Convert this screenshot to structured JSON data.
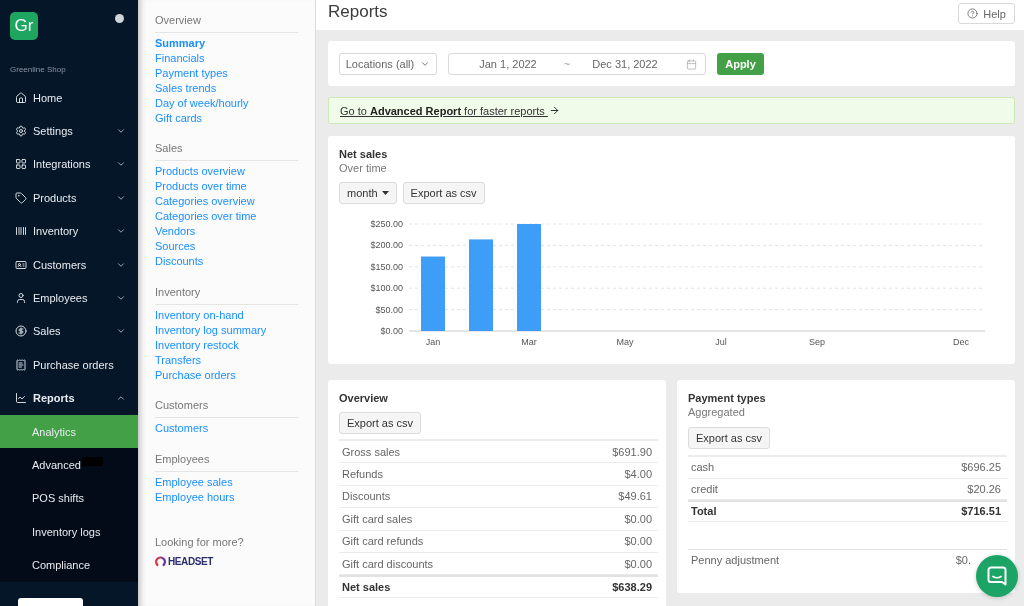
{
  "sidebar": {
    "logo": "Gr",
    "shop_name": "Greenline Shop",
    "items": [
      {
        "label": "Home",
        "kind": "link",
        "selected": false
      },
      {
        "label": "Settings",
        "kind": "group",
        "expanded": false,
        "selected": false
      },
      {
        "label": "Integrations",
        "kind": "group",
        "expanded": false,
        "selected": false
      },
      {
        "label": "Products",
        "kind": "group",
        "expanded": false,
        "selected": false
      },
      {
        "label": "Inventory",
        "kind": "group",
        "expanded": false,
        "selected": false
      },
      {
        "label": "Customers",
        "kind": "group",
        "expanded": false,
        "selected": false
      },
      {
        "label": "Employees",
        "kind": "group",
        "expanded": false,
        "selected": false
      },
      {
        "label": "Sales",
        "kind": "group",
        "expanded": false,
        "selected": false
      },
      {
        "label": "Purchase orders",
        "kind": "link",
        "selected": false
      },
      {
        "label": "Reports",
        "kind": "group",
        "expanded": true,
        "selected": true,
        "children": [
          {
            "label": "Analytics",
            "selected": true,
            "redacted": false
          },
          {
            "label": "Advanced",
            "selected": false,
            "redacted": true
          },
          {
            "label": "POS shifts",
            "selected": false,
            "redacted": false
          },
          {
            "label": "Inventory logs",
            "selected": false,
            "redacted": false
          },
          {
            "label": "Compliance",
            "selected": false,
            "redacted": false
          }
        ]
      }
    ]
  },
  "report_nav": {
    "sections": [
      {
        "title": "Overview",
        "items": [
          {
            "label": "Summary",
            "selected": true
          },
          {
            "label": "Financials",
            "selected": false
          },
          {
            "label": "Payment types",
            "selected": false
          },
          {
            "label": "Sales trends",
            "selected": false
          },
          {
            "label": "Day of week/hourly",
            "selected": false
          },
          {
            "label": "Gift cards",
            "selected": false
          }
        ]
      },
      {
        "title": "Sales",
        "items": [
          {
            "label": "Products overview",
            "selected": false
          },
          {
            "label": "Products over time",
            "selected": false
          },
          {
            "label": "Categories overview",
            "selected": false
          },
          {
            "label": "Categories over time",
            "selected": false
          },
          {
            "label": "Vendors",
            "selected": false
          },
          {
            "label": "Sources",
            "selected": false
          },
          {
            "label": "Discounts",
            "selected": false
          }
        ]
      },
      {
        "title": "Inventory",
        "items": [
          {
            "label": "Inventory on-hand",
            "selected": false
          },
          {
            "label": "Inventory log summary",
            "selected": false
          },
          {
            "label": "Inventory restock",
            "selected": false
          },
          {
            "label": "Transfers",
            "selected": false
          },
          {
            "label": "Purchase orders",
            "selected": false
          }
        ]
      },
      {
        "title": "Customers",
        "items": [
          {
            "label": "Customers",
            "selected": false
          }
        ]
      },
      {
        "title": "Employees",
        "items": [
          {
            "label": "Employee sales",
            "selected": false
          },
          {
            "label": "Employee hours",
            "selected": false
          }
        ]
      }
    ],
    "more_label": "Looking for more?",
    "brand": "HEADSET"
  },
  "header": {
    "title": "Reports",
    "help_button": "Help"
  },
  "filters": {
    "location": "Locations (all)",
    "date_start": "Jan 1, 2022",
    "date_separator": "~",
    "date_end": "Dec 31, 2022",
    "apply_button": "Apply"
  },
  "banner": "Go to **Advanced Report** for faster reports",
  "net_sales": {
    "title": "Net sales",
    "subtitle": "Over time",
    "period": "month",
    "export_button": "Export as csv",
    "chart_data": {
      "type": "bar",
      "categories": [
        "Jan",
        null,
        "Mar",
        null,
        "May",
        null,
        "Jul",
        null,
        "Sep",
        null,
        null,
        "Dec"
      ],
      "values": [
        174,
        214,
        250,
        null,
        null,
        null,
        null,
        null,
        null,
        null,
        null,
        null
      ],
      "ylim": [
        0,
        250
      ],
      "yticks": [
        {
          "value": 0,
          "label": "$0.00"
        },
        {
          "value": 50,
          "label": "$50.00"
        },
        {
          "value": 100,
          "label": "$100.00"
        },
        {
          "value": 150,
          "label": "$150.00"
        },
        {
          "value": 200,
          "label": "$200.00"
        },
        {
          "value": 250,
          "label": "$250.00"
        }
      ],
      "grid": true
    }
  },
  "overview": {
    "title": "Overview",
    "export_button": "Export as csv",
    "rows": [
      {
        "label": "Gross sales",
        "value": "$691.90",
        "kind": "item"
      },
      {
        "label": "Refunds",
        "value": "$4.00",
        "kind": "item"
      },
      {
        "label": "Discounts",
        "value": "$49.61",
        "kind": "item"
      },
      {
        "label": "Gift card sales",
        "value": "$0.00",
        "kind": "item"
      },
      {
        "label": "Gift card refunds",
        "value": "$0.00",
        "kind": "item"
      },
      {
        "label": "Gift card discounts",
        "value": "$0.00",
        "kind": "item"
      },
      {
        "label": "Net sales",
        "value": "$638.29",
        "kind": "total"
      }
    ]
  },
  "payment_types": {
    "title": "Payment types",
    "subtitle": "Aggregated",
    "export_button": "Export as csv",
    "rows": [
      {
        "label": "cash",
        "value": "$696.25",
        "kind": "item"
      },
      {
        "label": "credit",
        "value": "$20.26",
        "kind": "item"
      },
      {
        "label": "Total",
        "value": "$716.51",
        "kind": "total"
      },
      {
        "label": "Penny adjustment",
        "value": "$0.",
        "kind": "adjustment"
      }
    ]
  }
}
